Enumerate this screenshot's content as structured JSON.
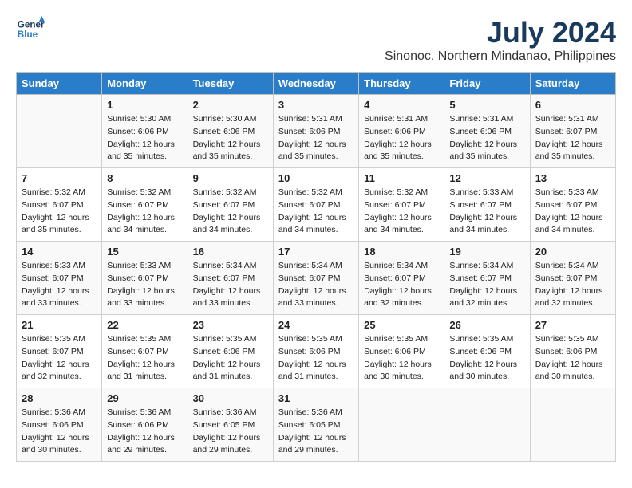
{
  "logo": {
    "line1": "General",
    "line2": "Blue"
  },
  "title": "July 2024",
  "subtitle": "Sinonoc, Northern Mindanao, Philippines",
  "days_header": [
    "Sunday",
    "Monday",
    "Tuesday",
    "Wednesday",
    "Thursday",
    "Friday",
    "Saturday"
  ],
  "weeks": [
    [
      {
        "day": "",
        "info": ""
      },
      {
        "day": "1",
        "info": "Sunrise: 5:30 AM\nSunset: 6:06 PM\nDaylight: 12 hours\nand 35 minutes."
      },
      {
        "day": "2",
        "info": "Sunrise: 5:30 AM\nSunset: 6:06 PM\nDaylight: 12 hours\nand 35 minutes."
      },
      {
        "day": "3",
        "info": "Sunrise: 5:31 AM\nSunset: 6:06 PM\nDaylight: 12 hours\nand 35 minutes."
      },
      {
        "day": "4",
        "info": "Sunrise: 5:31 AM\nSunset: 6:06 PM\nDaylight: 12 hours\nand 35 minutes."
      },
      {
        "day": "5",
        "info": "Sunrise: 5:31 AM\nSunset: 6:06 PM\nDaylight: 12 hours\nand 35 minutes."
      },
      {
        "day": "6",
        "info": "Sunrise: 5:31 AM\nSunset: 6:07 PM\nDaylight: 12 hours\nand 35 minutes."
      }
    ],
    [
      {
        "day": "7",
        "info": "Sunrise: 5:32 AM\nSunset: 6:07 PM\nDaylight: 12 hours\nand 35 minutes."
      },
      {
        "day": "8",
        "info": "Sunrise: 5:32 AM\nSunset: 6:07 PM\nDaylight: 12 hours\nand 34 minutes."
      },
      {
        "day": "9",
        "info": "Sunrise: 5:32 AM\nSunset: 6:07 PM\nDaylight: 12 hours\nand 34 minutes."
      },
      {
        "day": "10",
        "info": "Sunrise: 5:32 AM\nSunset: 6:07 PM\nDaylight: 12 hours\nand 34 minutes."
      },
      {
        "day": "11",
        "info": "Sunrise: 5:32 AM\nSunset: 6:07 PM\nDaylight: 12 hours\nand 34 minutes."
      },
      {
        "day": "12",
        "info": "Sunrise: 5:33 AM\nSunset: 6:07 PM\nDaylight: 12 hours\nand 34 minutes."
      },
      {
        "day": "13",
        "info": "Sunrise: 5:33 AM\nSunset: 6:07 PM\nDaylight: 12 hours\nand 34 minutes."
      }
    ],
    [
      {
        "day": "14",
        "info": "Sunrise: 5:33 AM\nSunset: 6:07 PM\nDaylight: 12 hours\nand 33 minutes."
      },
      {
        "day": "15",
        "info": "Sunrise: 5:33 AM\nSunset: 6:07 PM\nDaylight: 12 hours\nand 33 minutes."
      },
      {
        "day": "16",
        "info": "Sunrise: 5:34 AM\nSunset: 6:07 PM\nDaylight: 12 hours\nand 33 minutes."
      },
      {
        "day": "17",
        "info": "Sunrise: 5:34 AM\nSunset: 6:07 PM\nDaylight: 12 hours\nand 33 minutes."
      },
      {
        "day": "18",
        "info": "Sunrise: 5:34 AM\nSunset: 6:07 PM\nDaylight: 12 hours\nand 32 minutes."
      },
      {
        "day": "19",
        "info": "Sunrise: 5:34 AM\nSunset: 6:07 PM\nDaylight: 12 hours\nand 32 minutes."
      },
      {
        "day": "20",
        "info": "Sunrise: 5:34 AM\nSunset: 6:07 PM\nDaylight: 12 hours\nand 32 minutes."
      }
    ],
    [
      {
        "day": "21",
        "info": "Sunrise: 5:35 AM\nSunset: 6:07 PM\nDaylight: 12 hours\nand 32 minutes."
      },
      {
        "day": "22",
        "info": "Sunrise: 5:35 AM\nSunset: 6:07 PM\nDaylight: 12 hours\nand 31 minutes."
      },
      {
        "day": "23",
        "info": "Sunrise: 5:35 AM\nSunset: 6:06 PM\nDaylight: 12 hours\nand 31 minutes."
      },
      {
        "day": "24",
        "info": "Sunrise: 5:35 AM\nSunset: 6:06 PM\nDaylight: 12 hours\nand 31 minutes."
      },
      {
        "day": "25",
        "info": "Sunrise: 5:35 AM\nSunset: 6:06 PM\nDaylight: 12 hours\nand 30 minutes."
      },
      {
        "day": "26",
        "info": "Sunrise: 5:35 AM\nSunset: 6:06 PM\nDaylight: 12 hours\nand 30 minutes."
      },
      {
        "day": "27",
        "info": "Sunrise: 5:35 AM\nSunset: 6:06 PM\nDaylight: 12 hours\nand 30 minutes."
      }
    ],
    [
      {
        "day": "28",
        "info": "Sunrise: 5:36 AM\nSunset: 6:06 PM\nDaylight: 12 hours\nand 30 minutes."
      },
      {
        "day": "29",
        "info": "Sunrise: 5:36 AM\nSunset: 6:06 PM\nDaylight: 12 hours\nand 29 minutes."
      },
      {
        "day": "30",
        "info": "Sunrise: 5:36 AM\nSunset: 6:05 PM\nDaylight: 12 hours\nand 29 minutes."
      },
      {
        "day": "31",
        "info": "Sunrise: 5:36 AM\nSunset: 6:05 PM\nDaylight: 12 hours\nand 29 minutes."
      },
      {
        "day": "",
        "info": ""
      },
      {
        "day": "",
        "info": ""
      },
      {
        "day": "",
        "info": ""
      }
    ]
  ]
}
